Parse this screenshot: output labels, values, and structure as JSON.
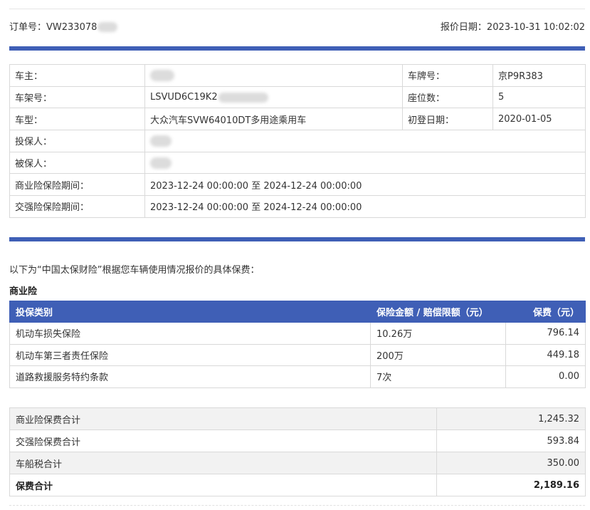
{
  "header": {
    "order_label": "订单号：",
    "order_no": "VW233078",
    "quote_date_label": "报价日期：",
    "quote_date": "2023-10-31 10:02:02"
  },
  "vehicle": {
    "owner_label": "车主：",
    "plate_label": "车牌号：",
    "plate_value": "京P9R383",
    "vin_label": "车架号：",
    "vin_value": "LSVUD6C19K2",
    "seats_label": "座位数：",
    "seats_value": "5",
    "model_label": "车型：",
    "model_value": "大众汽车SVW64010DT多用途乘用车",
    "first_reg_label": "初登日期：",
    "first_reg_value": "2020-01-05",
    "applicant_label": "投保人：",
    "insured_label": "被保人：",
    "commercial_period_label": "商业险保险期间：",
    "commercial_period_value": "2023-12-24 00:00:00 至 2024-12-24 00:00:00",
    "compulsory_period_label": "交强险保险期间：",
    "compulsory_period_value": "2023-12-24 00:00:00 至 2024-12-24 00:00:00"
  },
  "intro_text": "以下为“中国太保财险”根据您车辆使用情况报价的具体保费：",
  "commercial": {
    "title": "商业险",
    "headers": [
      "投保类别",
      "保险金额 / 赔偿限额（元）",
      "保费（元）"
    ],
    "rows": [
      {
        "name": "机动车损失保险",
        "amount": "10.26万",
        "premium": "796.14"
      },
      {
        "name": "机动车第三者责任保险",
        "amount": "200万",
        "premium": "449.18"
      },
      {
        "name": "道路救援服务特约条款",
        "amount": "7次",
        "premium": "0.00"
      }
    ]
  },
  "summary": {
    "commercial_total_label": "商业险保费合计",
    "commercial_total": "1,245.32",
    "compulsory_total_label": "交强险保费合计",
    "compulsory_total": "593.84",
    "tax_label": "车船税合计",
    "tax": "350.00",
    "grand_total_label": "保费合计",
    "grand_total": "2,189.16"
  },
  "colors": {
    "accent": "#3f5fb6",
    "border": "#d9d9d9",
    "row_gray": "#f2f2f2"
  }
}
